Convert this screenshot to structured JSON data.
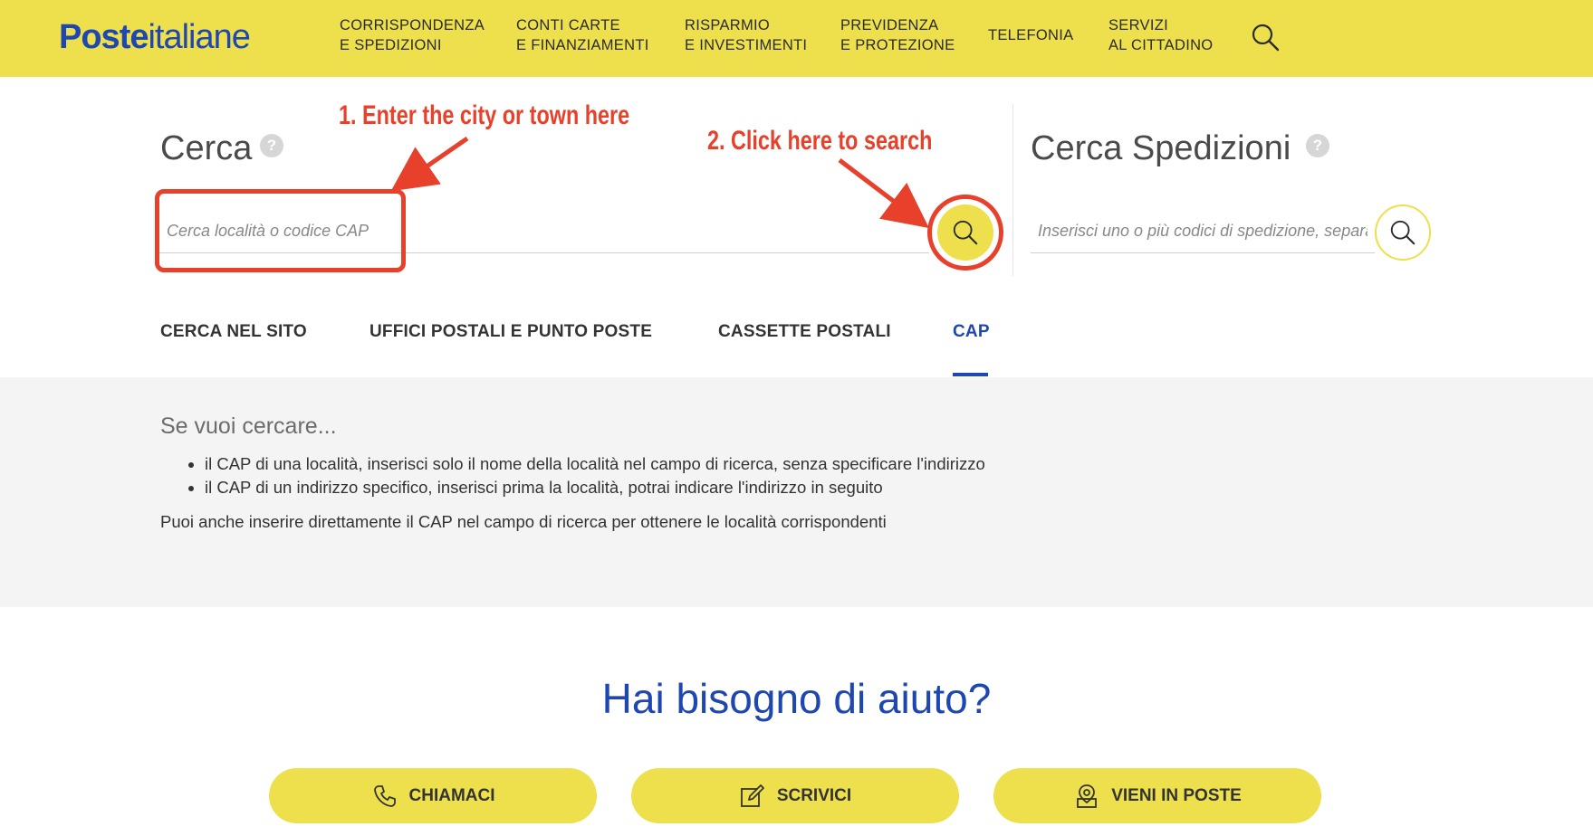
{
  "header": {
    "logo_bold": "Poste",
    "logo_light": "italiane",
    "nav": [
      {
        "line1": "CORRISPONDENZA",
        "line2": "E SPEDIZIONI"
      },
      {
        "line1": "CONTI CARTE",
        "line2": "E FINANZIAMENTI"
      },
      {
        "line1": "RISPARMIO",
        "line2": "E INVESTIMENTI"
      },
      {
        "line1": "PREVIDENZA",
        "line2": "E PROTEZIONE"
      },
      {
        "line1": "TELEFONIA",
        "line2": ""
      },
      {
        "line1": "SERVIZI",
        "line2": "AL CITTADINO"
      }
    ],
    "search_icon": "search-icon"
  },
  "search": {
    "title": "Cerca",
    "help": "?",
    "placeholder": "Cerca località o codice CAP",
    "button_icon": "search-icon"
  },
  "shipping": {
    "title": "Cerca Spedizioni",
    "help": "?",
    "placeholder": "Inserisci uno o più codici di spedizione, separati da virgola",
    "button_icon": "search-icon"
  },
  "tabs": [
    {
      "label": "CERCA NEL SITO",
      "active": false
    },
    {
      "label": "UFFICI POSTALI E PUNTO POSTE",
      "active": false
    },
    {
      "label": "CASSETTE POSTALI",
      "active": false
    },
    {
      "label": "CAP",
      "active": true
    }
  ],
  "info": {
    "title": "Se vuoi cercare...",
    "items": [
      "il CAP di una località, inserisci solo il nome della località nel campo di ricerca, senza specificare l'indirizzo",
      "il CAP di un indirizzo specifico, inserisci prima la località, potrai indicare l'indirizzo in seguito"
    ],
    "note": "Puoi anche inserire direttamente il CAP nel campo di ricerca per ottenere le località corrispondenti"
  },
  "help_section": {
    "title": "Hai bisogno di aiuto?",
    "buttons": [
      {
        "label": "CHIAMACI",
        "icon": "phone-icon"
      },
      {
        "label": "SCRIVICI",
        "icon": "pencil-icon"
      },
      {
        "label": "VIENI IN POSTE",
        "icon": "location-pin-icon"
      }
    ]
  },
  "annotations": {
    "step1": "1.  Enter the city or town here",
    "step2": "2.  Click here to search"
  },
  "colors": {
    "brand_yellow": "#ede04c",
    "brand_blue": "#1f47b2",
    "annotation_red": "#e8412b",
    "panel_gray": "#f4f4f4"
  }
}
